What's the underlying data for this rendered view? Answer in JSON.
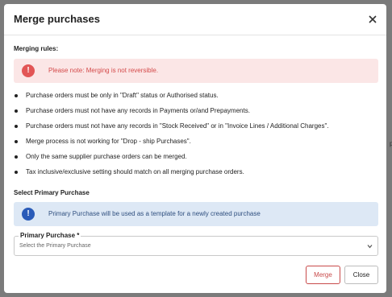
{
  "background": {
    "peek_text": "p"
  },
  "dialog": {
    "title": "Merge purchases",
    "merging_rules_label": "Merging rules:",
    "warning_text": "Please note: Merging is not reversible.",
    "warning_icon": "!",
    "rules": [
      "Purchase orders must be only in \"Draft\" status or Authorised status.",
      "Purchase orders must not have any records in Payments or/and Prepayments.",
      "Purchase orders must not have any records in \"Stock Received\" or in \"Invoice Lines / Additional Charges\".",
      "Merge process is not working for \"Drop - ship Purchases\".",
      "Only the same supplier purchase orders can be merged.",
      "Tax inclusive/exclusive setting should match on all merging purchase orders."
    ],
    "select_primary_label": "Select Primary Purchase",
    "info_text": "Primary Purchase will be used as a template for a newly created purchase",
    "info_icon": "!",
    "primary_field": {
      "label": "Primary Purchase *",
      "placeholder": "Select the Primary Purchase"
    },
    "buttons": {
      "merge": "Merge",
      "close": "Close"
    }
  },
  "colors": {
    "warning_bg": "#fbe6e6",
    "warning_text": "#d44a4a",
    "info_bg": "#dde8f5",
    "info_icon": "#2a5bb8",
    "merge_button": "#c84a4a"
  },
  "icons": {
    "close": "close-icon",
    "warning": "alert-circle-icon",
    "info": "info-circle-icon",
    "dropdown": "chevron-down-icon"
  }
}
